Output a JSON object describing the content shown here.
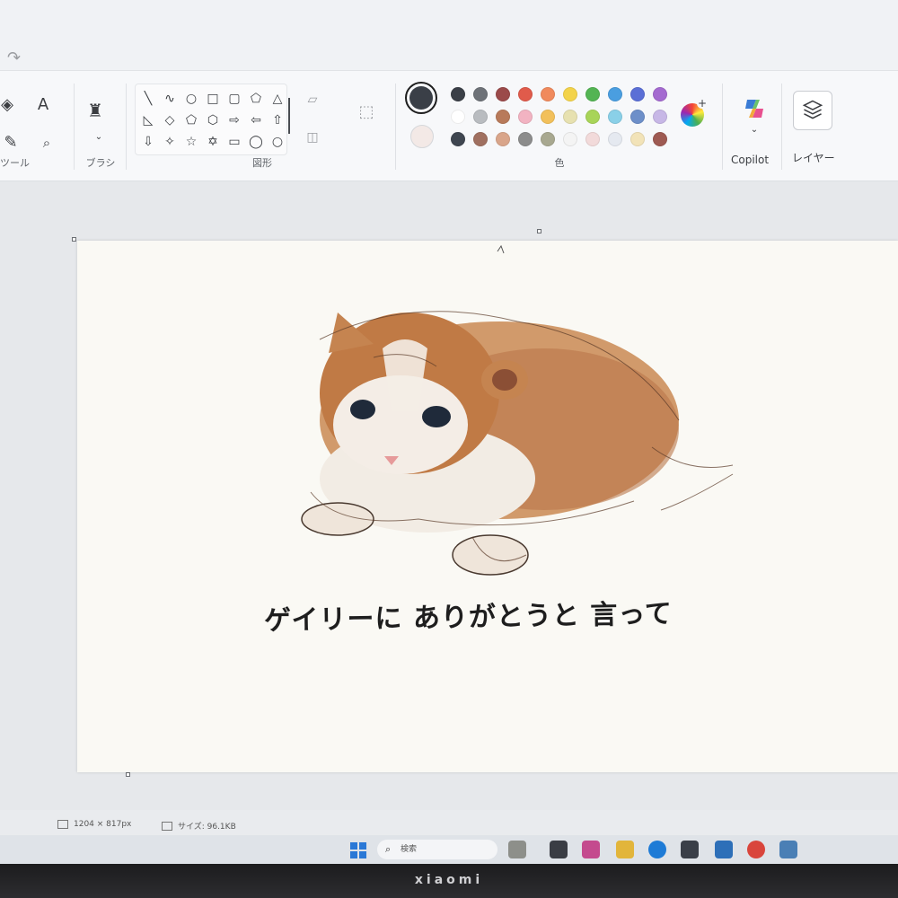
{
  "ribbon": {
    "tools_label": "ツール",
    "text_tool": "A",
    "brushes_label": "ブラシ",
    "shapes_label": "図形",
    "colors_label": "色",
    "copilot_label": "Copilot",
    "layers_label": "レイヤー",
    "current_colors": [
      "#3a3f47",
      "#f3e9e6"
    ],
    "palette": [
      "#3a3f47",
      "#6e7278",
      "#9b4a4a",
      "#e05b4b",
      "#f08a5d",
      "#f3d34a",
      "#53b453",
      "#4a9ee0",
      "#5b6fd6",
      "#a46ad0",
      "#ffffff",
      "#b9bcc0",
      "#b87a5a",
      "#f2b3c2",
      "#f2c05b",
      "#e7e1b0",
      "#a8d458",
      "#8ad0e8",
      "#6d8fc9",
      "#c7b7e6",
      "#3f4650",
      "#a07060",
      "#d9a58a",
      "#8c8c8c",
      "#a8a890",
      "#f4f4f4",
      "#f2dada",
      "#e5e9f0",
      "#f2e3b8",
      "#9e5a52"
    ]
  },
  "canvas": {
    "caption": "ゲイリーに ありがとうと 言って"
  },
  "status": {
    "dimensions": "1204 × 817px",
    "size": "サイズ: 96.1KB"
  },
  "taskbar": {
    "search_label": "検索"
  },
  "bezel": {
    "brand": "xiaomi"
  }
}
